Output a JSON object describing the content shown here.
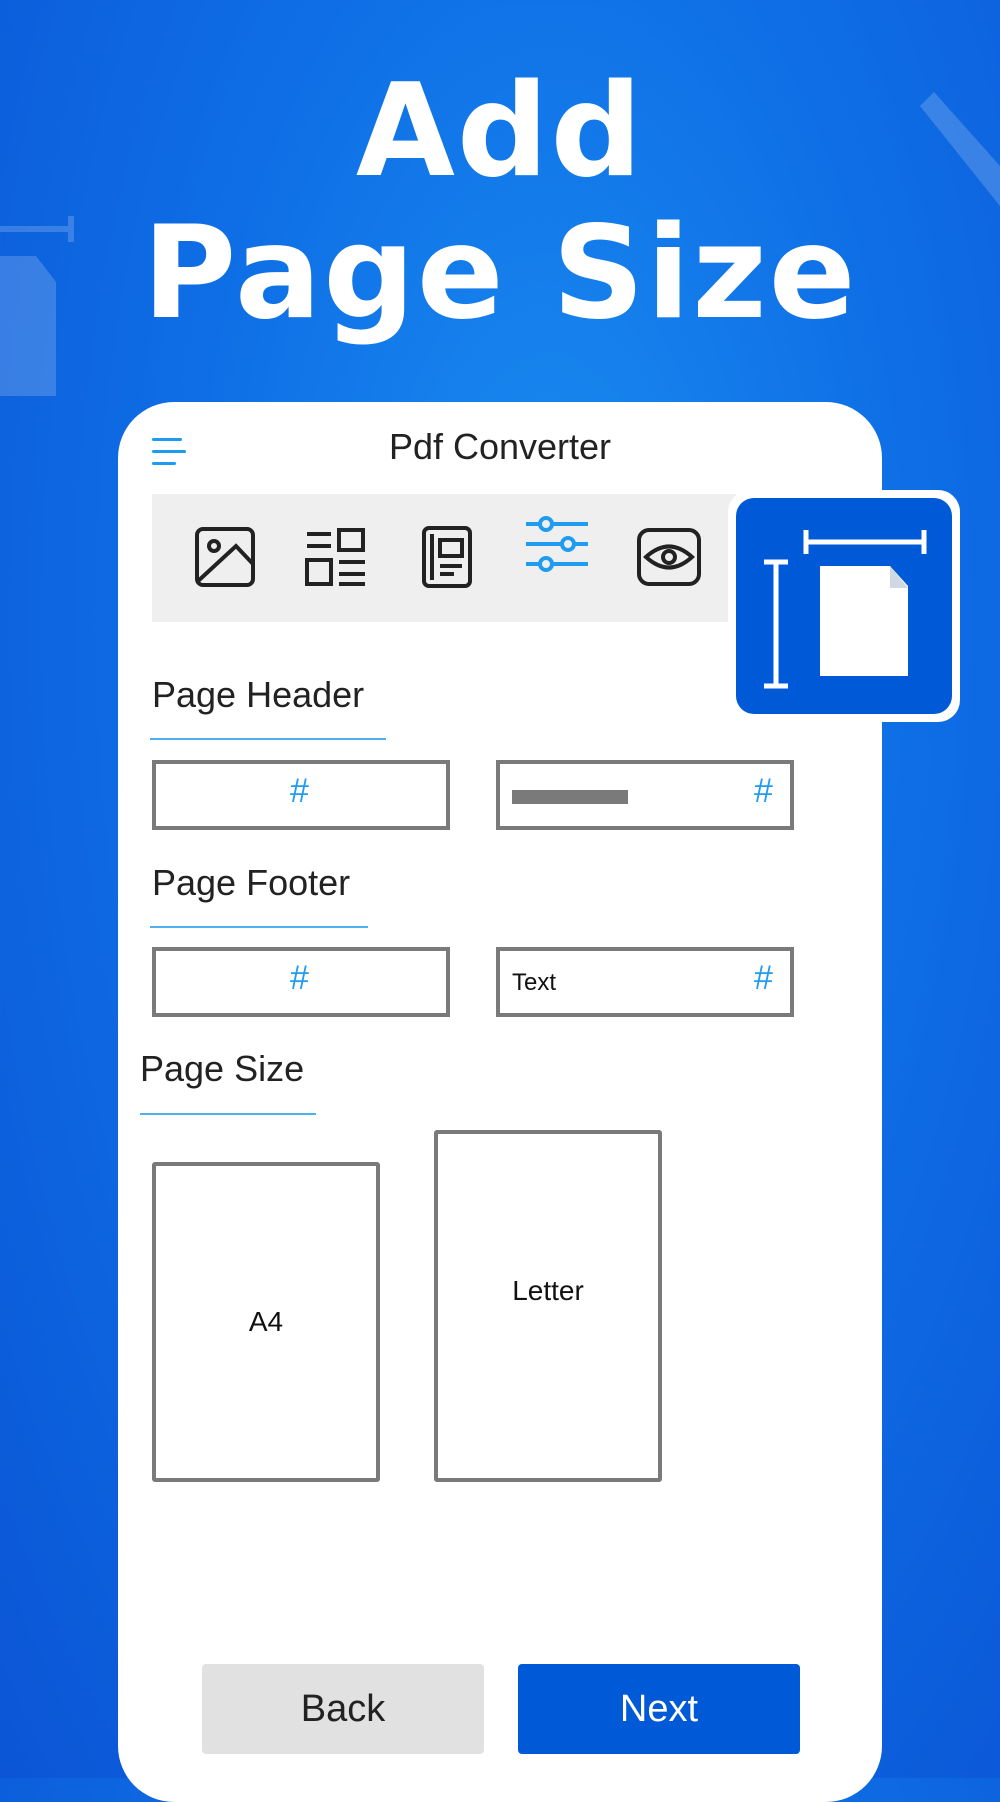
{
  "headline": {
    "line1": "Add",
    "line2": "Page Size"
  },
  "app": {
    "title": "Pdf Converter",
    "toolbar_icons": [
      "image-icon",
      "layout-icon",
      "document-icon",
      "sliders-icon",
      "eye-icon"
    ],
    "active_tool": "sliders-icon"
  },
  "page_header": {
    "label": "Page Header",
    "left_field": {
      "symbol": "#"
    },
    "right_field": {
      "symbol": "#"
    }
  },
  "page_footer": {
    "label": "Page Footer",
    "left_field": {
      "symbol": "#"
    },
    "right_field": {
      "value": "Text",
      "symbol": "#"
    }
  },
  "page_size": {
    "label": "Page Size",
    "options": [
      "A4",
      "Letter"
    ]
  },
  "buttons": {
    "back": "Back",
    "next": "Next"
  },
  "badge_icon": "page-size-icon",
  "colors": {
    "background": "#0f6fe6",
    "accent": "#1f9cf0",
    "primary_button": "#0059d6",
    "secondary_button": "#e1e1e1"
  }
}
